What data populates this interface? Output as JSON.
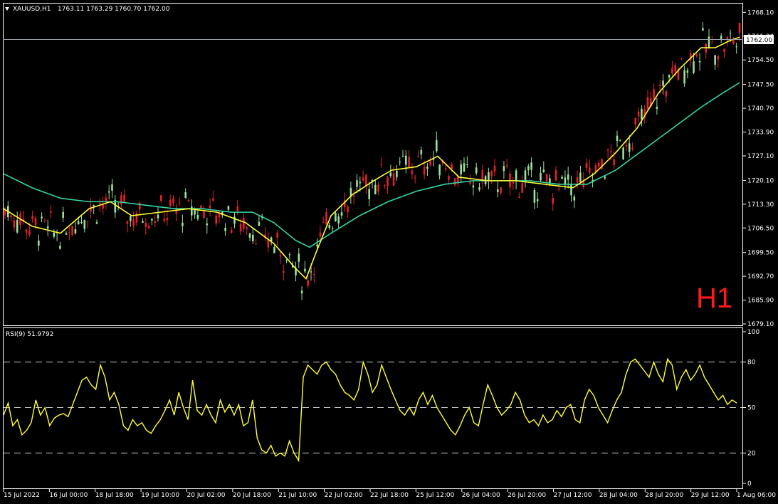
{
  "header": {
    "symbol": "XAUUSD,H1",
    "ohlc": "1763.11 1763.29 1760.70 1762.00",
    "dropdown_icon": "triangle-down-icon"
  },
  "timeframe_label": "H1",
  "current_price_label": "1762.00",
  "price_axis": {
    "ticks": [
      "1768.10",
      "1761.30",
      "1754.50",
      "1747.50",
      "1740.70",
      "1733.90",
      "1727.10",
      "1720.10",
      "1713.30",
      "1706.50",
      "1699.50",
      "1692.70",
      "1685.90",
      "1679.10"
    ],
    "min": 1679.1,
    "max": 1770.0
  },
  "rsi_panel": {
    "title": "RSI(9) 51.9792",
    "ticks": [
      "100",
      "80",
      "50",
      "20",
      "0"
    ],
    "levels": [
      80,
      50,
      20
    ]
  },
  "time_axis": {
    "labels": [
      "15 Jul 2022",
      "16 Jul 00:00",
      "18 Jul 18:00",
      "19 Jul 10:00",
      "20 Jul 02:00",
      "20 Jul 18:00",
      "21 Jul 10:00",
      "22 Jul 02:00",
      "22 Jul 18:00",
      "25 Jul 12:00",
      "26 Jul 04:00",
      "26 Jul 20:00",
      "27 Jul 12:00",
      "28 Jul 04:00",
      "28 Jul 20:00",
      "29 Jul 12:00",
      "1 Aug 06:00"
    ]
  },
  "colors": {
    "background": "#000000",
    "bull_candle": "#9be29b",
    "bear_candle": "#e8202a",
    "ma_fast": "#ffff33",
    "ma_slow": "#33d6a8",
    "rsi_line": "#ffff33",
    "grid_dashed": "#c8c8c8",
    "axis": "#ffffff",
    "timeframe_text": "#ff1a1a"
  },
  "chart_data": {
    "type": "candlestick",
    "ma_fast_points": [
      [
        0,
        1712
      ],
      [
        40,
        1707
      ],
      [
        80,
        1705
      ],
      [
        120,
        1712
      ],
      [
        150,
        1714
      ],
      [
        180,
        1710
      ],
      [
        220,
        1711
      ],
      [
        260,
        1712
      ],
      [
        300,
        1711
      ],
      [
        340,
        1708
      ],
      [
        380,
        1702
      ],
      [
        410,
        1695
      ],
      [
        425,
        1692
      ],
      [
        440,
        1700
      ],
      [
        460,
        1710
      ],
      [
        490,
        1716
      ],
      [
        520,
        1720
      ],
      [
        545,
        1723
      ],
      [
        580,
        1724
      ],
      [
        610,
        1727
      ],
      [
        640,
        1721
      ],
      [
        680,
        1720
      ],
      [
        720,
        1720
      ],
      [
        760,
        1719
      ],
      [
        800,
        1718
      ],
      [
        830,
        1722
      ],
      [
        860,
        1728
      ],
      [
        890,
        1735
      ],
      [
        920,
        1745
      ],
      [
        950,
        1752
      ],
      [
        980,
        1758
      ],
      [
        1000,
        1758
      ],
      [
        1020,
        1760
      ],
      [
        1034,
        1761
      ]
    ],
    "ma_slow_points": [
      [
        0,
        1722
      ],
      [
        40,
        1718
      ],
      [
        80,
        1715
      ],
      [
        120,
        1714
      ],
      [
        160,
        1714
      ],
      [
        200,
        1713
      ],
      [
        240,
        1712
      ],
      [
        280,
        1712
      ],
      [
        320,
        1711
      ],
      [
        350,
        1711
      ],
      [
        380,
        1708
      ],
      [
        410,
        1703
      ],
      [
        430,
        1701
      ],
      [
        460,
        1705
      ],
      [
        500,
        1710
      ],
      [
        540,
        1714
      ],
      [
        580,
        1717
      ],
      [
        620,
        1719
      ],
      [
        660,
        1720
      ],
      [
        700,
        1720
      ],
      [
        740,
        1720
      ],
      [
        780,
        1719
      ],
      [
        820,
        1719
      ],
      [
        860,
        1723
      ],
      [
        900,
        1729
      ],
      [
        940,
        1735
      ],
      [
        980,
        1741
      ],
      [
        1010,
        1745
      ],
      [
        1034,
        1748
      ]
    ],
    "rsi_values": [
      45,
      53,
      38,
      42,
      32,
      35,
      40,
      55,
      45,
      50,
      38,
      43,
      45,
      46,
      44,
      52,
      60,
      68,
      70,
      65,
      62,
      78,
      70,
      55,
      60,
      52,
      38,
      35,
      42,
      38,
      40,
      35,
      33,
      38,
      42,
      48,
      55,
      45,
      60,
      50,
      42,
      68,
      48,
      45,
      52,
      45,
      40,
      55,
      47,
      52,
      45,
      52,
      38,
      40,
      55,
      30,
      22,
      20,
      25,
      18,
      20,
      18,
      28,
      20,
      15,
      70,
      78,
      75,
      72,
      78,
      80,
      75,
      72,
      65,
      60,
      58,
      55,
      62,
      80,
      72,
      60,
      65,
      78,
      70,
      62,
      55,
      48,
      45,
      50,
      45,
      55,
      60,
      52,
      58,
      50,
      45,
      40,
      35,
      32,
      38,
      45,
      50,
      40,
      38,
      52,
      65,
      58,
      50,
      45,
      48,
      52,
      60,
      55,
      45,
      40,
      42,
      38,
      45,
      40,
      42,
      48,
      44,
      50,
      52,
      42,
      40,
      55,
      62,
      58,
      50,
      45,
      40,
      48,
      55,
      60,
      72,
      80,
      82,
      78,
      74,
      70,
      80,
      72,
      67,
      82,
      78,
      62,
      70,
      75,
      68,
      72,
      78,
      70,
      65,
      60,
      55,
      58,
      52,
      55,
      53
    ],
    "price_ylim": [
      1679.1,
      1770.0
    ],
    "rsi_ylim": [
      0,
      100
    ]
  }
}
